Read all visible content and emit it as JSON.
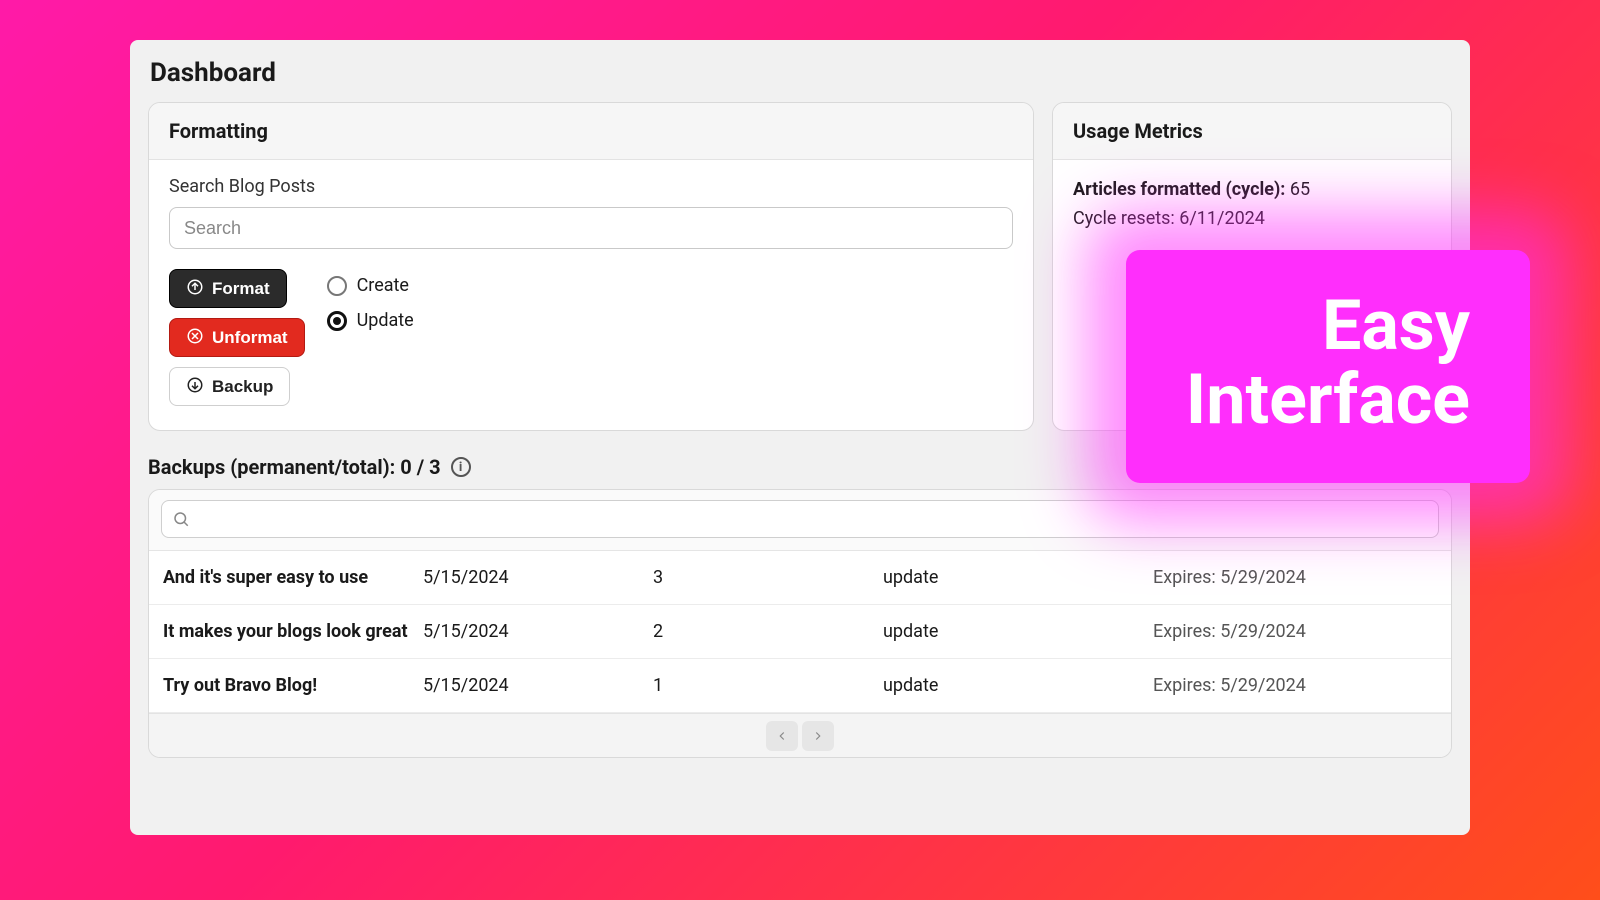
{
  "page": {
    "title": "Dashboard"
  },
  "formatting": {
    "card_title": "Formatting",
    "search_label": "Search Blog Posts",
    "search_placeholder": "Search",
    "buttons": {
      "format": "Format",
      "unformat": "Unformat",
      "backup": "Backup"
    },
    "radios": {
      "create": "Create",
      "update": "Update",
      "selected": "update"
    }
  },
  "metrics": {
    "card_title": "Usage Metrics",
    "articles_label": "Articles formatted (cycle):",
    "articles_value": "65",
    "cycle_resets_label": "Cycle resets:",
    "cycle_resets_value": "6/11/2024"
  },
  "backups": {
    "title": "Backups (permanent/total): 0 / 3",
    "rows": [
      {
        "title": "And it's super easy to use",
        "date": "5/15/2024",
        "count": "3",
        "mode": "update",
        "expires": "Expires: 5/29/2024"
      },
      {
        "title": "It makes your blogs look great",
        "date": "5/15/2024",
        "count": "2",
        "mode": "update",
        "expires": "Expires: 5/29/2024"
      },
      {
        "title": "Try out Bravo Blog!",
        "date": "5/15/2024",
        "count": "1",
        "mode": "update",
        "expires": "Expires: 5/29/2024"
      }
    ]
  },
  "callout": {
    "line1": "Easy",
    "line2": "Interface"
  }
}
